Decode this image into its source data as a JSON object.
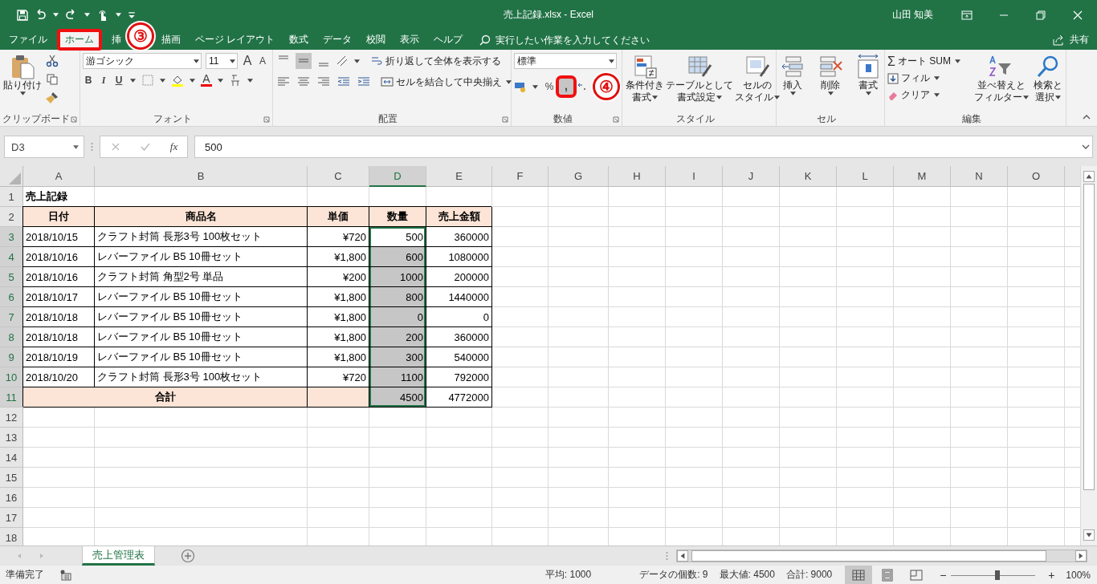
{
  "title_bar": {
    "title": "売上記録.xlsx  -  Excel",
    "user": "山田 知美"
  },
  "tabs": [
    {
      "label": "ファイル",
      "selected": false,
      "highlighted": false
    },
    {
      "label": "ホーム",
      "selected": true,
      "highlighted": true
    },
    {
      "label": "挿",
      "selected": false,
      "highlighted": false,
      "callout": "③"
    },
    {
      "label": "描画",
      "selected": false,
      "highlighted": false
    },
    {
      "label": "ページ レイアウト",
      "selected": false,
      "highlighted": false
    },
    {
      "label": "数式",
      "selected": false,
      "highlighted": false
    },
    {
      "label": "データ",
      "selected": false,
      "highlighted": false
    },
    {
      "label": "校閲",
      "selected": false,
      "highlighted": false
    },
    {
      "label": "表示",
      "selected": false,
      "highlighted": false
    },
    {
      "label": "ヘルプ",
      "selected": false,
      "highlighted": false
    }
  ],
  "tell_me": {
    "placeholder": "実行したい作業を入力してください"
  },
  "share": "共有",
  "ribbon": {
    "clipboard": {
      "label": "クリップボード",
      "paste": "貼り付け"
    },
    "font": {
      "label": "フォント",
      "name": "游ゴシック",
      "size": "11",
      "grow": "A",
      "shrink": "A",
      "bold": "B",
      "italic": "I",
      "underline": "U",
      "color_letter": "A"
    },
    "alignment": {
      "label": "配置",
      "vertical": [
        {
          "selected": false
        },
        {
          "selected": true
        },
        {
          "selected": false
        }
      ],
      "wrap": "折り返して全体を表示する",
      "merge": "セルを結合して中央揃え"
    },
    "number": {
      "label": "数値",
      "format": "標準",
      "percent": "%",
      "comma": ",",
      "comma_highlighted": true,
      "callout": "④"
    },
    "styles": {
      "label": "スタイル",
      "buttons": [
        {
          "kind": "conditional",
          "lines": [
            "条件付き",
            "書式"
          ]
        },
        {
          "kind": "table",
          "lines": [
            "テーブルとして",
            "書式設定"
          ]
        },
        {
          "kind": "cellstyle",
          "lines": [
            "セルの",
            "スタイル"
          ]
        }
      ]
    },
    "cells": {
      "label": "セル",
      "buttons": [
        {
          "kind": "insert",
          "label": "挿入"
        },
        {
          "kind": "delete",
          "label": "削除"
        },
        {
          "kind": "format",
          "label": "書式"
        }
      ]
    },
    "editing": {
      "label": "編集",
      "autosum_icon": "Σ",
      "autosum": "オート SUM",
      "fill": "フィル",
      "clear": "クリア",
      "sort": [
        "並べ替えと",
        "フィルター"
      ],
      "find": [
        "検索と",
        "選択"
      ]
    }
  },
  "formula_bar": {
    "name_box": "D3",
    "fx": "fx",
    "value": "500"
  },
  "columns": [
    {
      "label": "A",
      "selected": false
    },
    {
      "label": "B",
      "selected": false
    },
    {
      "label": "C",
      "selected": false
    },
    {
      "label": "D",
      "selected": true
    },
    {
      "label": "E",
      "selected": false
    },
    {
      "label": "F",
      "selected": false
    },
    {
      "label": "G",
      "selected": false
    },
    {
      "label": "H",
      "selected": false
    },
    {
      "label": "I",
      "selected": false
    },
    {
      "label": "J",
      "selected": false
    },
    {
      "label": "K",
      "selected": false
    },
    {
      "label": "L",
      "selected": false
    },
    {
      "label": "M",
      "selected": false
    },
    {
      "label": "N",
      "selected": false
    },
    {
      "label": "O",
      "selected": false
    }
  ],
  "rows": [
    {
      "header": "1",
      "kind": "title",
      "selected": false,
      "cells": [
        "売上記録"
      ]
    },
    {
      "header": "2",
      "kind": "header",
      "selected": false,
      "cells": [
        "日付",
        "商品名",
        "単価",
        "数量",
        "売上金額"
      ]
    },
    {
      "header": "3",
      "kind": "data",
      "selected": true,
      "cells": [
        "2018/10/15",
        "クラフト封筒 長形3号 100枚セット",
        "¥720",
        "500",
        "360000"
      ]
    },
    {
      "header": "4",
      "kind": "data",
      "selected": true,
      "cells": [
        "2018/10/16",
        "レバーファイル B5 10冊セット",
        "¥1,800",
        "600",
        "1080000"
      ]
    },
    {
      "header": "5",
      "kind": "data",
      "selected": true,
      "cells": [
        "2018/10/16",
        "クラフト封筒 角型2号 単品",
        "¥200",
        "1000",
        "200000"
      ]
    },
    {
      "header": "6",
      "kind": "data",
      "selected": true,
      "cells": [
        "2018/10/17",
        "レバーファイル B5 10冊セット",
        "¥1,800",
        "800",
        "1440000"
      ]
    },
    {
      "header": "7",
      "kind": "data",
      "selected": true,
      "cells": [
        "2018/10/18",
        "レバーファイル B5 10冊セット",
        "¥1,800",
        "0",
        "0"
      ]
    },
    {
      "header": "8",
      "kind": "data",
      "selected": true,
      "cells": [
        "2018/10/18",
        "レバーファイル B5 10冊セット",
        "¥1,800",
        "200",
        "360000"
      ]
    },
    {
      "header": "9",
      "kind": "data",
      "selected": true,
      "cells": [
        "2018/10/19",
        "レバーファイル B5 10冊セット",
        "¥1,800",
        "300",
        "540000"
      ]
    },
    {
      "header": "10",
      "kind": "data",
      "selected": true,
      "cells": [
        "2018/10/20",
        "クラフト封筒 長形3号 100枚セット",
        "¥720",
        "1100",
        "792000"
      ]
    },
    {
      "header": "11",
      "kind": "total",
      "selected": true,
      "cells": [
        "合計",
        null,
        "4500",
        "4772000"
      ]
    },
    {
      "header": "12",
      "kind": "empty",
      "selected": false
    },
    {
      "header": "13",
      "kind": "empty",
      "selected": false
    },
    {
      "header": "14",
      "kind": "empty",
      "selected": false
    },
    {
      "header": "15",
      "kind": "empty",
      "selected": false
    },
    {
      "header": "16",
      "kind": "empty",
      "selected": false
    },
    {
      "header": "17",
      "kind": "empty",
      "selected": false
    },
    {
      "header": "18",
      "kind": "empty",
      "selected": false
    }
  ],
  "sheet_tabs": [
    {
      "label": "売上管理表",
      "selected": true
    }
  ],
  "status_bar": {
    "status": "準備完了",
    "stats": [
      "平均: 1000",
      "データの個数: 9",
      "最大値: 4500",
      "合計: 9000"
    ],
    "views": [
      {
        "kind": "normal",
        "selected": true
      },
      {
        "kind": "page_layout",
        "selected": false
      },
      {
        "kind": "page_break",
        "selected": false
      }
    ],
    "zoom": {
      "minus": "−",
      "plus": "+",
      "level": 0.55,
      "label": "100%"
    }
  }
}
